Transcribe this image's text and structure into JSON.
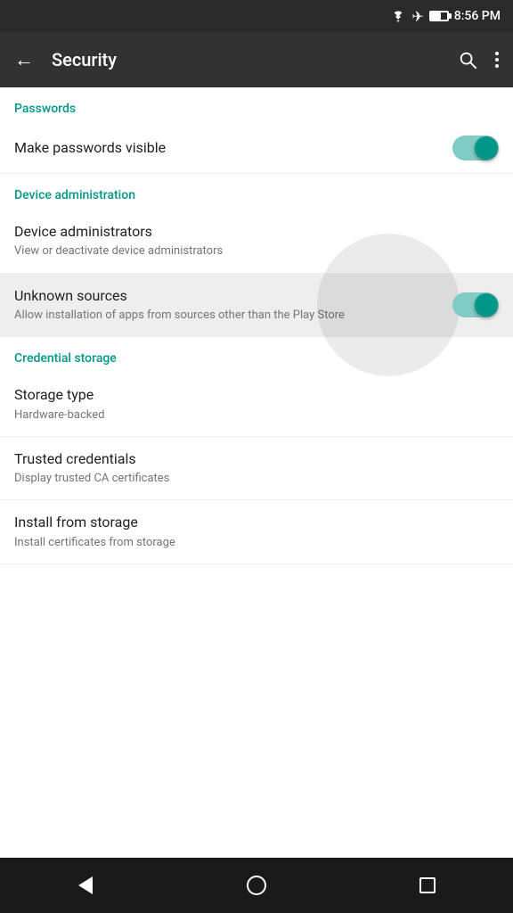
{
  "statusBar": {
    "time": "8:56 PM"
  },
  "appBar": {
    "title": "Security",
    "backLabel": "←",
    "searchLabel": "🔍",
    "moreLabel": "⋮"
  },
  "sections": [
    {
      "id": "passwords",
      "header": "Passwords",
      "items": [
        {
          "id": "make-passwords-visible",
          "title": "Make passwords visible",
          "subtitle": "",
          "hasToggle": true,
          "toggleOn": true,
          "highlighted": false
        }
      ]
    },
    {
      "id": "device-administration",
      "header": "Device administration",
      "items": [
        {
          "id": "device-administrators",
          "title": "Device administrators",
          "subtitle": "View or deactivate device administrators",
          "hasToggle": false,
          "highlighted": false
        },
        {
          "id": "unknown-sources",
          "title": "Unknown sources",
          "subtitle": "Allow installation of apps from sources other than the Play Store",
          "hasToggle": true,
          "toggleOn": true,
          "highlighted": true
        }
      ]
    },
    {
      "id": "credential-storage",
      "header": "Credential storage",
      "items": [
        {
          "id": "storage-type",
          "title": "Storage type",
          "subtitle": "Hardware-backed",
          "hasToggle": false,
          "highlighted": false
        },
        {
          "id": "trusted-credentials",
          "title": "Trusted credentials",
          "subtitle": "Display trusted CA certificates",
          "hasToggle": false,
          "highlighted": false
        },
        {
          "id": "install-from-storage",
          "title": "Install from storage",
          "subtitle": "Install certificates from storage",
          "hasToggle": false,
          "highlighted": false
        }
      ]
    }
  ],
  "navBar": {
    "backLabel": "back",
    "homeLabel": "home",
    "recentLabel": "recent"
  }
}
